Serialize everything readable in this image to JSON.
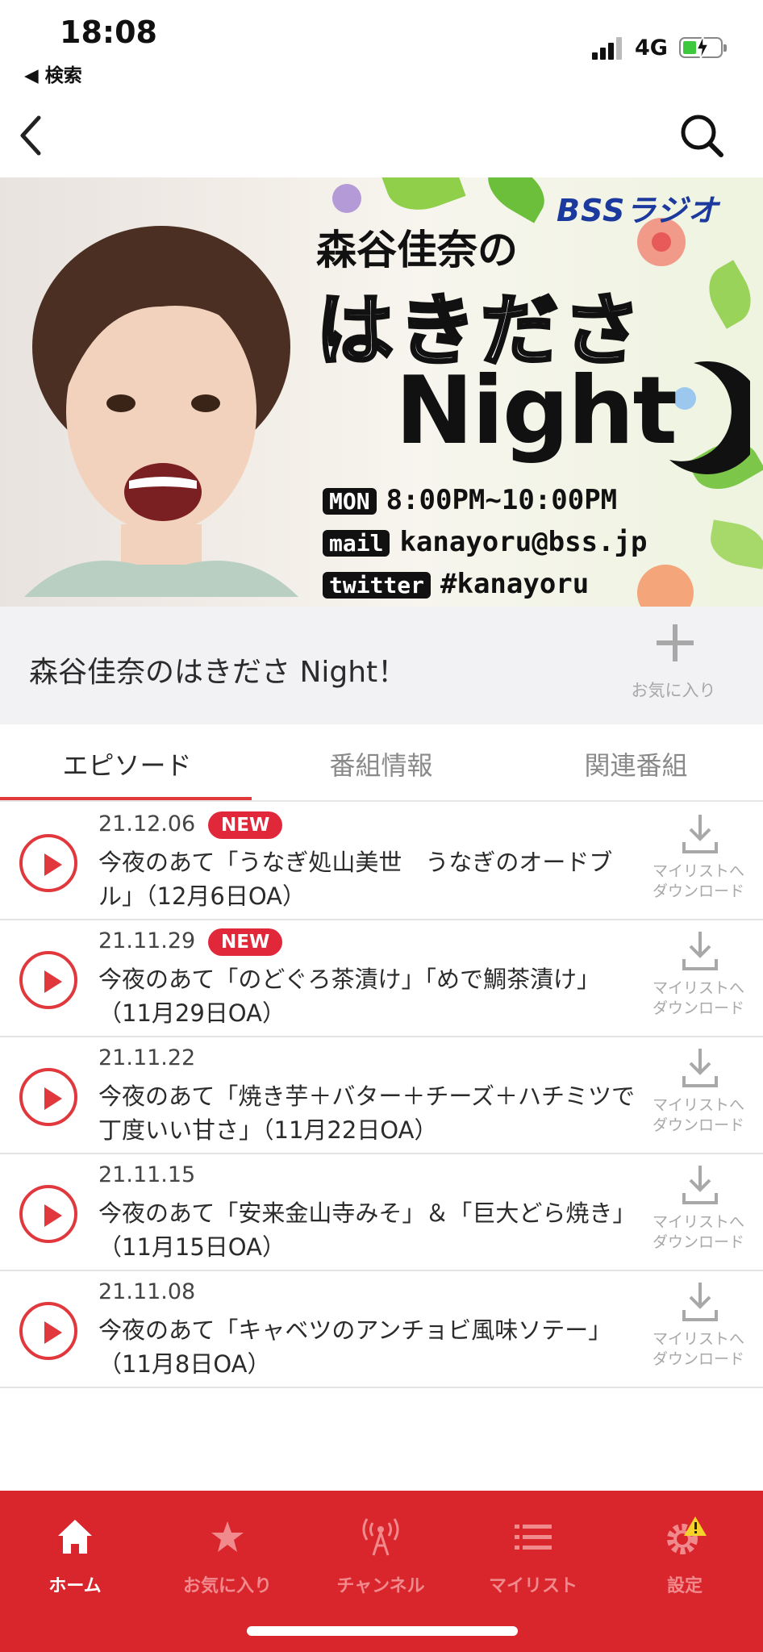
{
  "status_bar": {
    "time": "18:08",
    "back_app": "◀ 検索",
    "network": "4G"
  },
  "nav": {
    "back_icon": "chevron-left-icon",
    "search_icon": "search-icon"
  },
  "hero": {
    "logo": "BSSラジオ",
    "line1": "森谷佳奈の",
    "line2": "はきださ",
    "line3": "Night",
    "schedule_tag": "MON",
    "schedule": "8:00PM~10:00PM",
    "mail_tag": "mail",
    "mail": "kanayoru@bss.jp",
    "twitter_tag": "twitter",
    "twitter": "#kanayoru"
  },
  "program": {
    "title": "森谷佳奈のはきださ Night！",
    "favorite_label": "お気に入り"
  },
  "tabs": [
    {
      "label": "エピソード",
      "active": true
    },
    {
      "label": "番組情報",
      "active": false
    },
    {
      "label": "関連番組",
      "active": false
    }
  ],
  "episodes": [
    {
      "date": "21.12.06",
      "badge": "NEW",
      "title": "今夜のあて「うなぎ処山美世　うなぎのオードブル」（12月6日OA）",
      "download_label": "マイリストへ\nダウンロード"
    },
    {
      "date": "21.11.29",
      "badge": "NEW",
      "title": "今夜のあて「のどぐろ茶漬け」「めで鯛茶漬け」（11月29日OA）",
      "download_label": "マイリストへ\nダウンロード"
    },
    {
      "date": "21.11.22",
      "badge": "",
      "title": "今夜のあて「焼き芋＋バター＋チーズ＋ハチミツで丁度いい甘さ」（11月22日OA）",
      "download_label": "マイリストへ\nダウンロード"
    },
    {
      "date": "21.11.15",
      "badge": "",
      "title": "今夜のあて「安来金山寺みそ」＆「巨大どら焼き」（11月15日OA）",
      "download_label": "マイリストへ\nダウンロード"
    },
    {
      "date": "21.11.08",
      "badge": "",
      "title": "今夜のあて「キャベツのアンチョビ風味ソテー」（11月8日OA）",
      "download_label": "マイリストへ\nダウンロード"
    }
  ],
  "tabbar": [
    {
      "label": "ホーム",
      "icon": "home-icon",
      "active": true
    },
    {
      "label": "お気に入り",
      "icon": "star-icon",
      "active": false
    },
    {
      "label": "チャンネル",
      "icon": "antenna-icon",
      "active": false
    },
    {
      "label": "マイリスト",
      "icon": "list-icon",
      "active": false
    },
    {
      "label": "設定",
      "icon": "gear-warning-icon",
      "active": false
    }
  ],
  "colors": {
    "accent": "#e0383c",
    "tabbar_bg": "#d9262d",
    "badge_bg": "#e0283a"
  }
}
